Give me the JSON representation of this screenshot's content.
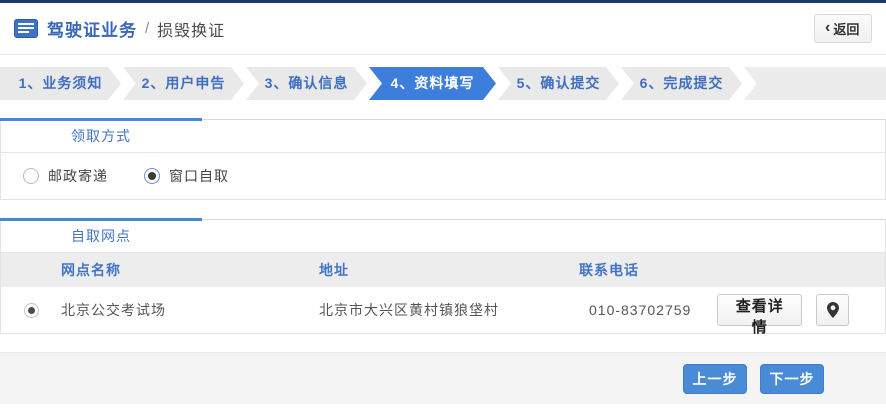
{
  "header": {
    "title_primary": "驾驶证业务",
    "title_separator": "/",
    "title_secondary": "损毁换证",
    "back_chevron": "‹",
    "back_label": "返回"
  },
  "steps": {
    "items": [
      {
        "label": "1、业务须知",
        "active": false
      },
      {
        "label": "2、用户申告",
        "active": false
      },
      {
        "label": "3、确认信息",
        "active": false
      },
      {
        "label": "4、资料填写",
        "active": true
      },
      {
        "label": "5、确认提交",
        "active": false
      },
      {
        "label": "6、完成提交",
        "active": false
      }
    ]
  },
  "pickup_section": {
    "title": "领取方式",
    "options": [
      {
        "label": "邮政寄递",
        "selected": false
      },
      {
        "label": "窗口自取",
        "selected": true
      }
    ]
  },
  "outlets_section": {
    "title": "自取网点",
    "columns": [
      "网点名称",
      "地址",
      "联系电话"
    ],
    "rows": [
      {
        "selected": true,
        "name": "北京公交考试场",
        "address": "北京市大兴区黄村镇狼垡村",
        "phone": "010-83702759",
        "detail_label": "查看详情",
        "map_icon": "location-pin"
      }
    ]
  },
  "footer": {
    "prev_label": "上一步",
    "next_label": "下一步"
  },
  "icons": {
    "header_icon": "license-card-icon",
    "back_icon": "chevron-left-icon",
    "row_icon": "location-pin-icon"
  },
  "colors": {
    "top_accent": "#1e3a68",
    "link_blue": "#4175c8",
    "active_tab_blue": "#3d7edd",
    "section_bar_blue": "#4a86d8",
    "primary_button_blue": "#4a8bd8"
  }
}
